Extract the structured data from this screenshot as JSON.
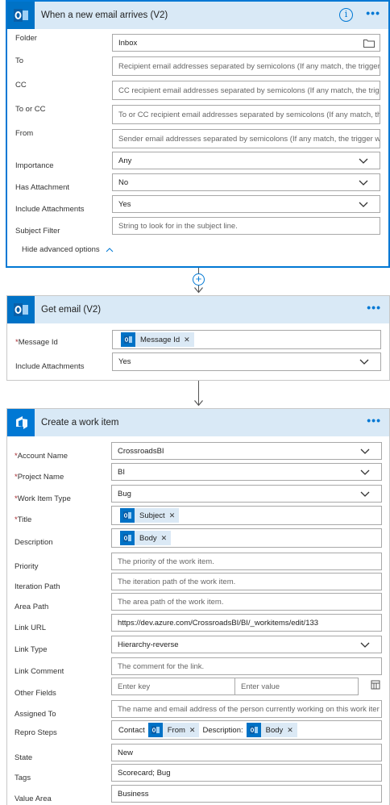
{
  "trigger": {
    "title": "When a new email arrives (V2)",
    "fields": {
      "folder_label": "Folder",
      "folder_value": "Inbox",
      "to_label": "To",
      "to_placeholder": "Recipient email addresses separated by semicolons (If any match, the trigger …",
      "cc_label": "CC",
      "cc_placeholder": "CC recipient email addresses separated by semicolons (If any match, the trig…",
      "toorcc_label": "To or CC",
      "toorcc_placeholder": "To or CC recipient email addresses separated by semicolons (If any match, th…",
      "from_label": "From",
      "from_placeholder": "Sender email addresses separated by semicolons (If any match, the trigger wi…",
      "importance_label": "Importance",
      "importance_value": "Any",
      "hasatt_label": "Has Attachment",
      "hasatt_value": "No",
      "inclatt_label": "Include Attachments",
      "inclatt_value": "Yes",
      "subject_label": "Subject Filter",
      "subject_placeholder": "String to look for in the subject line."
    },
    "hide_advanced": "Hide advanced options"
  },
  "get_email": {
    "title": "Get email (V2)",
    "message_id_label": "Message Id",
    "message_id_token": "Message Id",
    "include_attachments_label": "Include Attachments",
    "include_attachments_value": "Yes"
  },
  "work_item": {
    "title": "Create a work item",
    "account_label": "Account Name",
    "account_value": "CrossroadsBI",
    "project_label": "Project Name",
    "project_value": "BI",
    "type_label": "Work Item Type",
    "type_value": "Bug",
    "title_label": "Title",
    "title_token": "Subject",
    "desc_label": "Description",
    "desc_token": "Body",
    "priority_label": "Priority",
    "priority_placeholder": "The priority of the work item.",
    "iteration_label": "Iteration Path",
    "iteration_placeholder": "The iteration path of the work item.",
    "area_label": "Area Path",
    "area_placeholder": "The area path of the work item.",
    "link_url_label": "Link URL",
    "link_url_value": "https://dev.azure.com/CrossroadsBI/BI/_workitems/edit/133",
    "link_type_label": "Link Type",
    "link_type_value": "Hierarchy-reverse",
    "link_comment_label": "Link Comment",
    "link_comment_placeholder": "The comment for the link.",
    "other_label": "Other Fields",
    "other_key_placeholder": "Enter key",
    "other_value_placeholder": "Enter value",
    "assigned_label": "Assigned To",
    "assigned_placeholder": "The name and email address of the person currently working on this work iter",
    "repro_label": "Repro Steps",
    "repro_text1": "Contact",
    "repro_token1": "From",
    "repro_text2": "Description:",
    "repro_token2": "Body",
    "state_label": "State",
    "state_value": "New",
    "tags_label": "Tags",
    "tags_value": "Scorecard; Bug",
    "value_area_label": "Value Area",
    "value_area_value": "Business"
  },
  "colors": {
    "accent": "#0078d4",
    "header_bg": "#d9e9f6",
    "outlook_blue": "#0072c6",
    "devops_blue": "#0078d4"
  },
  "icons": [
    "outlook-icon",
    "devops-icon",
    "info-icon",
    "more-icon",
    "folder-icon",
    "chevron-down-icon",
    "add-icon",
    "close-icon",
    "table-switch-icon"
  ]
}
